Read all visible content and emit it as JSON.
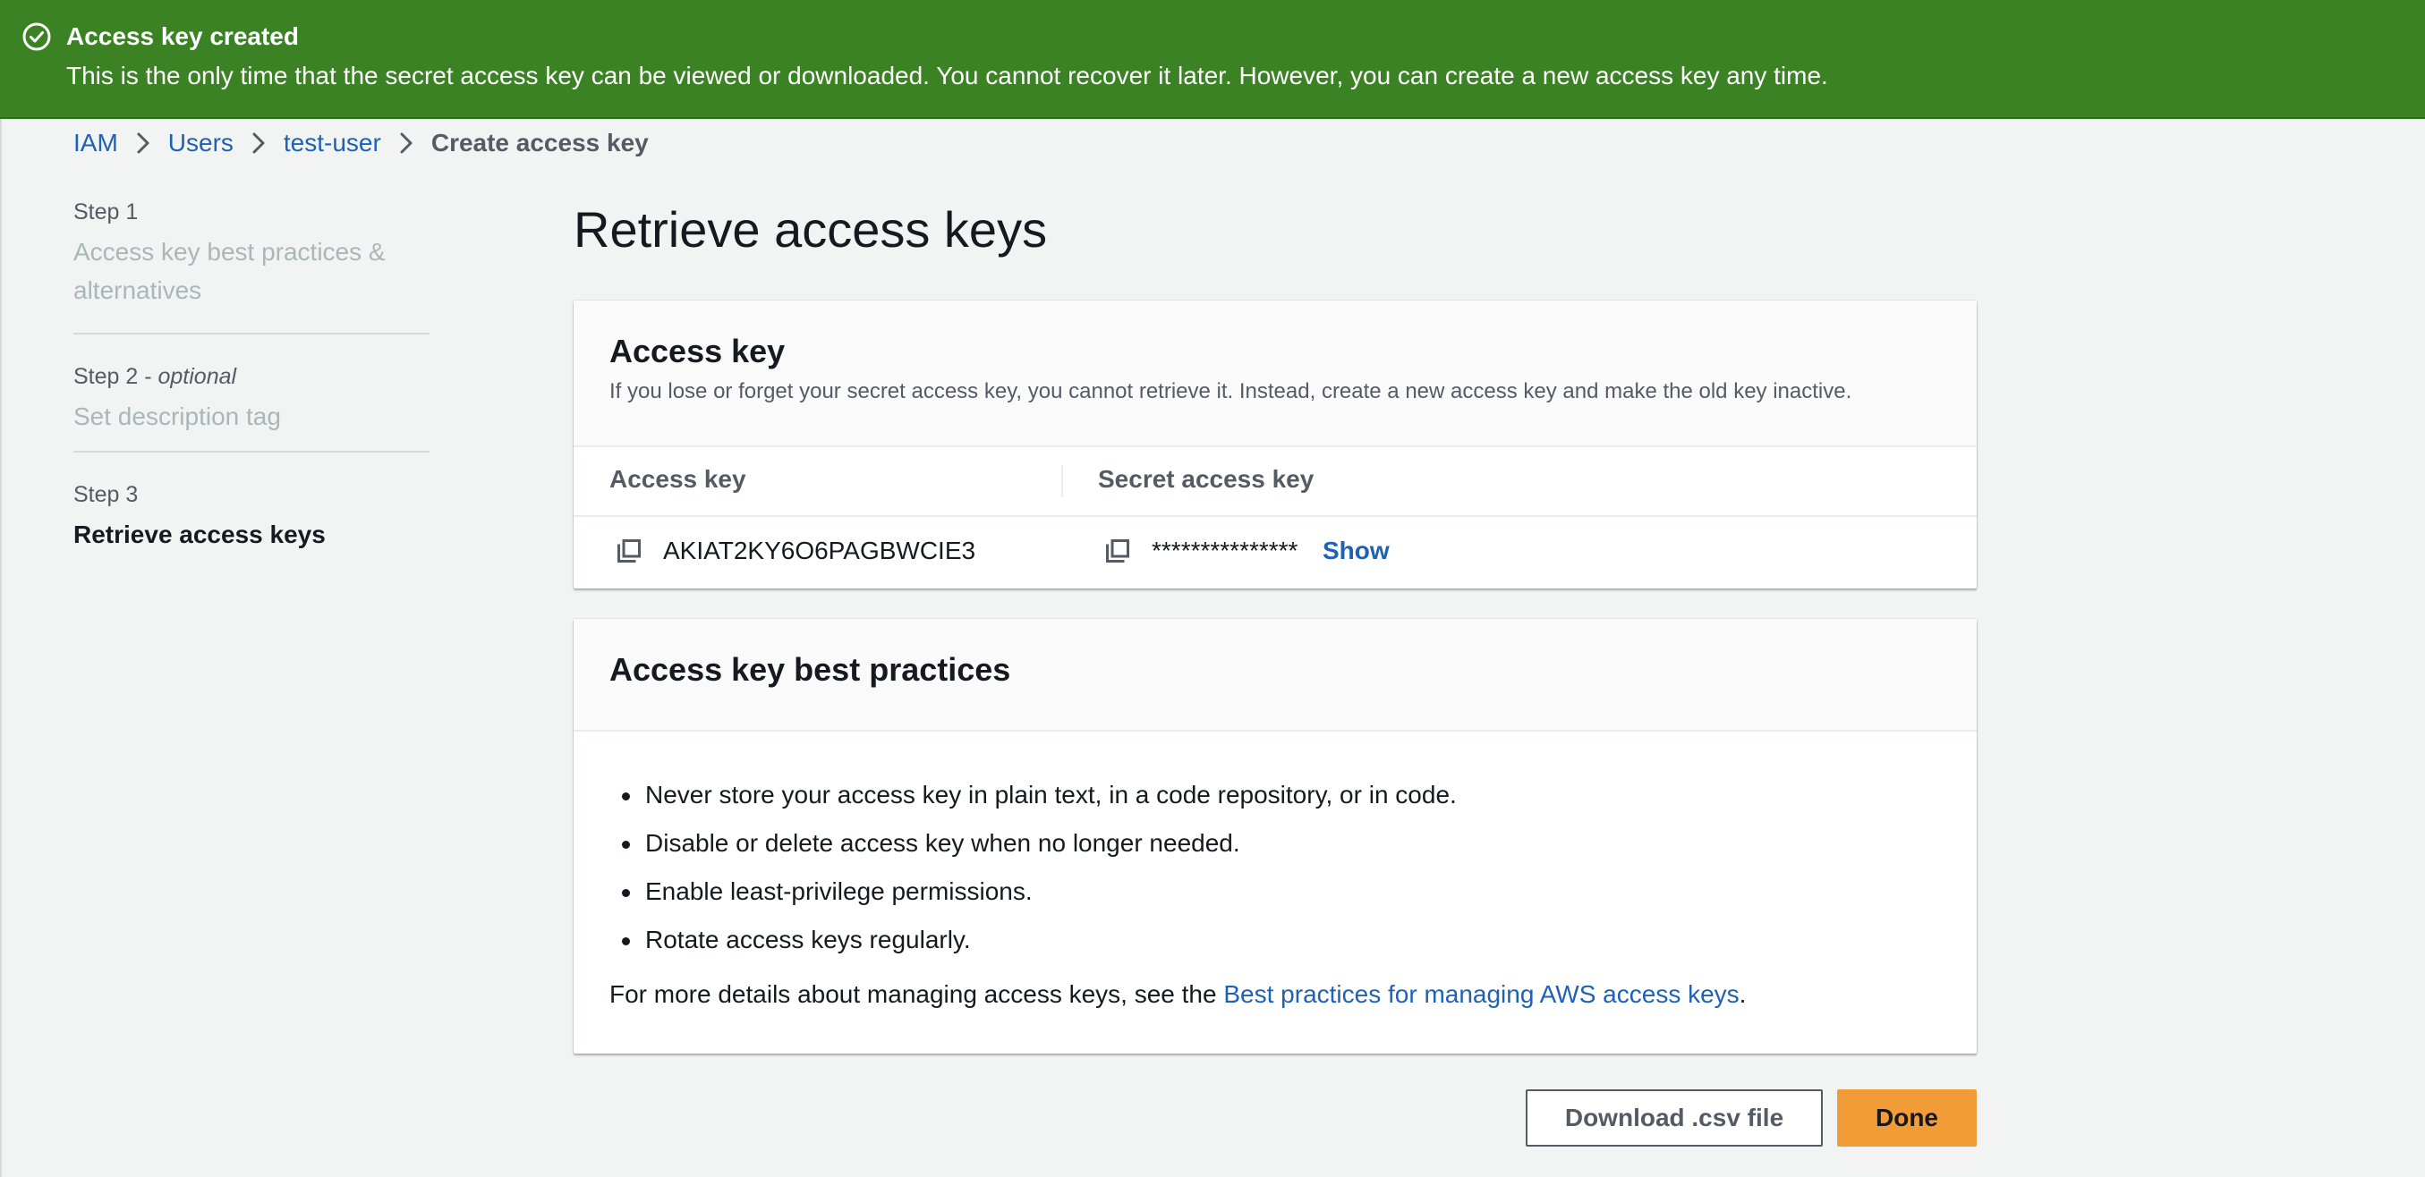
{
  "flash": {
    "title": "Access key created",
    "message": "This is the only time that the secret access key can be viewed or downloaded. You cannot recover it later. However, you can create a new access key any time.",
    "icon": "check-circle-icon",
    "color": "#3b8224"
  },
  "breadcrumb": {
    "items": [
      "IAM",
      "Users",
      "test-user"
    ],
    "current": "Create access key"
  },
  "steps": [
    {
      "number": "Step 1",
      "optional": "",
      "title": "Access key best practices &",
      "title2": "alternatives"
    },
    {
      "number": "Step 2 - ",
      "optional": "optional",
      "title": "Set description tag"
    },
    {
      "number": "Step 3",
      "optional": "",
      "title": "Retrieve access keys"
    }
  ],
  "main": {
    "title": "Retrieve access keys"
  },
  "access_key_card": {
    "title": "Access key",
    "description": "If you lose or forget your secret access key, you cannot retrieve it. Instead, create a new access key and make the old key inactive.",
    "columns": [
      "Access key",
      "Secret access key"
    ],
    "access_key_value": "AKIAT2KY6O6PAGBWCIE3",
    "secret_value": "***************",
    "show_label": "Show"
  },
  "best_practices_card": {
    "title": "Access key best practices",
    "items": [
      "Never store your access key in plain text, in a code repository, or in code.",
      "Disable or delete access key when no longer needed.",
      "Enable least-privilege permissions.",
      "Rotate access keys regularly."
    ],
    "footer_prefix": "For more details about managing access keys, see the ",
    "footer_link": "Best practices for managing AWS access keys",
    "footer_suffix": "."
  },
  "buttons": {
    "download": "Download .csv file",
    "done": "Done"
  },
  "colors": {
    "link": "#1f62b4",
    "primary_button": "#f29c38",
    "background": "#f2f3f3"
  }
}
